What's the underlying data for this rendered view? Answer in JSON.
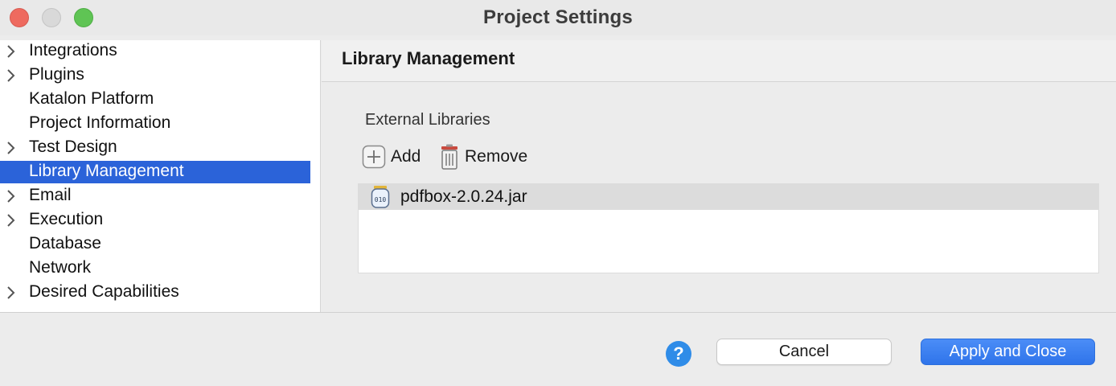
{
  "window": {
    "title": "Project Settings"
  },
  "sidebar": {
    "items": [
      {
        "label": "Integrations",
        "expandable": true,
        "selected": false
      },
      {
        "label": "Plugins",
        "expandable": true,
        "selected": false
      },
      {
        "label": "Katalon Platform",
        "expandable": false,
        "selected": false
      },
      {
        "label": "Project Information",
        "expandable": false,
        "selected": false
      },
      {
        "label": "Test Design",
        "expandable": true,
        "selected": false
      },
      {
        "label": "Library Management",
        "expandable": false,
        "selected": true
      },
      {
        "label": "Email",
        "expandable": true,
        "selected": false
      },
      {
        "label": "Execution",
        "expandable": true,
        "selected": false
      },
      {
        "label": "Database",
        "expandable": false,
        "selected": false
      },
      {
        "label": "Network",
        "expandable": false,
        "selected": false
      },
      {
        "label": "Desired Capabilities",
        "expandable": true,
        "selected": false
      }
    ]
  },
  "main": {
    "title": "Library Management",
    "section_label": "External Libraries",
    "toolbar": {
      "add_label": "Add",
      "remove_label": "Remove"
    },
    "libraries": [
      {
        "name": "pdfbox-2.0.24.jar",
        "icon": "jar-icon"
      }
    ]
  },
  "footer": {
    "help_label": "?",
    "cancel_label": "Cancel",
    "apply_label": "Apply and Close"
  },
  "colors": {
    "selection": "#2b63d9",
    "primary_button": "#3b82f6",
    "help": "#2f8ce8"
  }
}
